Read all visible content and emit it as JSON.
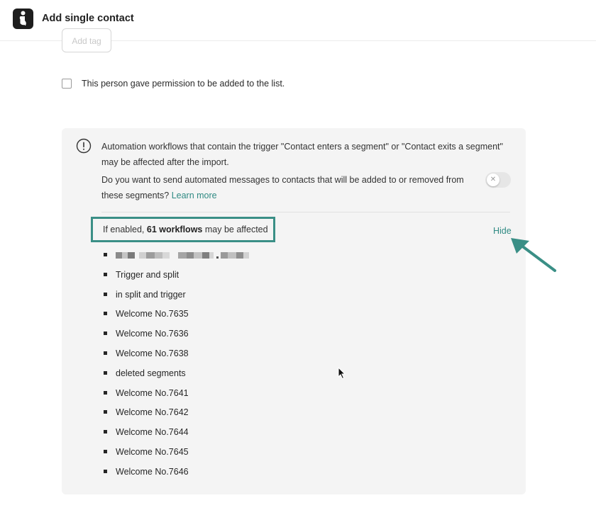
{
  "header": {
    "title": "Add single contact",
    "logo_icon": "brand-logo-icon"
  },
  "tag_button": {
    "label": "Add tag"
  },
  "permission": {
    "label": "This person gave permission to be added to the list.",
    "checked": false
  },
  "alert": {
    "icon": "exclamation-circle-icon",
    "text": "Automation workflows that contain the trigger \"Contact enters a segment\" or \"Contact exits a segment\" may be affected after the import.",
    "question": "Do you want to send automated messages to contacts that will be added to or removed from these segments?",
    "learn_more": "Learn more",
    "toggle_on": false,
    "toggle_icon": "x-icon"
  },
  "affected": {
    "prefix": "If enabled,",
    "bold": "61 workflows",
    "suffix": "may be affected",
    "hide_label": "Hide"
  },
  "workflows": [
    "Trigger and split",
    "in split and trigger",
    "Welcome No.7635",
    "Welcome No.7636",
    "Welcome No.7638",
    "deleted segments",
    "Welcome No.7641",
    "Welcome No.7642",
    "Welcome No.7644",
    "Welcome No.7645",
    "Welcome No.7646"
  ],
  "colors": {
    "accent": "#2f8a83",
    "highlight_border": "#3a8f86",
    "panel_bg": "#f4f4f4"
  }
}
